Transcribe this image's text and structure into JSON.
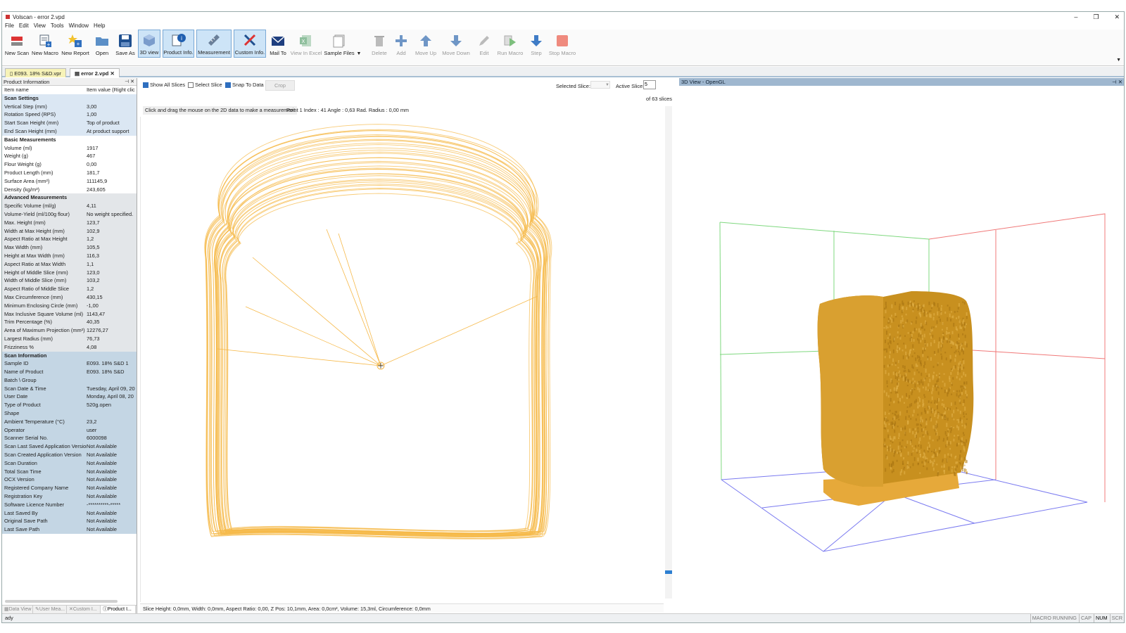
{
  "window": {
    "title": "Volscan - error 2.vpd",
    "minimize": "–",
    "restore": "❐",
    "close": "✕"
  },
  "menu": [
    "File",
    "Edit",
    "View",
    "Tools",
    "Window",
    "Help"
  ],
  "toolbar": {
    "new_scan": "New Scan",
    "new_macro": "New Macro",
    "new_report": "New Report",
    "open": "Open",
    "save_as": "Save As",
    "view3d": "3D view",
    "product_info": "Product Info.",
    "measurement": "Measurement",
    "custom_info": "Custom Info.",
    "mail_to": "Mail To",
    "view_in_excel": "View In Excel",
    "sample_files": "Sample Files",
    "delete": "Delete",
    "add": "Add",
    "move_up": "Move Up",
    "move_down": "Move Down",
    "edit": "Edit",
    "run_macro": "Run Macro",
    "step": "Step",
    "stop_macro": "Stop Macro"
  },
  "doc_tabs": [
    "E093. 18% S&D.vpr",
    "error 2.vpd"
  ],
  "product_panel": {
    "title": "Product Information",
    "header": {
      "k": "Item name",
      "v": "Item value (Right clic"
    },
    "rows": [
      {
        "k": "Scan Settings",
        "v": "",
        "sec": true,
        "g": "g1"
      },
      {
        "k": "Vertical Step (mm)",
        "v": "3,00",
        "g": "g1"
      },
      {
        "k": "Rotation Speed (RPS)",
        "v": "1,00",
        "g": "g1"
      },
      {
        "k": "Start Scan Height (mm)",
        "v": "Top of product",
        "g": "g1"
      },
      {
        "k": "End Scan Height (mm)",
        "v": "At product support",
        "g": "g1"
      },
      {
        "k": "Basic Measurements",
        "v": "",
        "sec": true,
        "g": "wh"
      },
      {
        "k": "Volume (ml)",
        "v": "1917",
        "g": "wh"
      },
      {
        "k": "Weight (g)",
        "v": "467",
        "g": "wh"
      },
      {
        "k": "Flour Weight (g)",
        "v": "0,00",
        "g": "wh"
      },
      {
        "k": "Product Length (mm)",
        "v": "181,7",
        "g": "wh"
      },
      {
        "k": "Surface Area (mm²)",
        "v": "111145,9",
        "g": "wh"
      },
      {
        "k": "Density (kg/m³)",
        "v": "243,605",
        "g": "wh"
      },
      {
        "k": "Advanced Measurements",
        "v": "",
        "sec": true,
        "g": "g2"
      },
      {
        "k": "Specific Volume (ml/g)",
        "v": "4,11",
        "g": "g2"
      },
      {
        "k": "Volume-Yield (ml/100g flour)",
        "v": "No weight specified.",
        "g": "g2"
      },
      {
        "k": "Max. Height (mm)",
        "v": "123,7",
        "g": "g2"
      },
      {
        "k": "Width at Max Height (mm)",
        "v": "102,9",
        "g": "g2"
      },
      {
        "k": "Aspect Ratio at Max Height",
        "v": "1,2",
        "g": "g2"
      },
      {
        "k": "Max Width (mm)",
        "v": "105,5",
        "g": "g2"
      },
      {
        "k": "Height at Max Width (mm)",
        "v": "116,3",
        "g": "g2"
      },
      {
        "k": "Aspect Ratio at Max Width",
        "v": "1,1",
        "g": "g2"
      },
      {
        "k": "Height of Middle Slice (mm)",
        "v": "123,0",
        "g": "g2"
      },
      {
        "k": "Width of Middle Slice (mm)",
        "v": "103,2",
        "g": "g2"
      },
      {
        "k": "Aspect Ratio of Middle Slice",
        "v": "1,2",
        "g": "g2"
      },
      {
        "k": "Max Circumference (mm)",
        "v": "430,15",
        "g": "g2"
      },
      {
        "k": "Minimum Enclosing Circle (mm)",
        "v": "-1,00",
        "g": "g2"
      },
      {
        "k": "Max Inclusive Square Volume (ml)",
        "v": "1143,47",
        "g": "g2"
      },
      {
        "k": "Trim Percentage (%)",
        "v": "40,35",
        "g": "g2"
      },
      {
        "k": "Area of Maximum Projection (mm²)",
        "v": "12276,27",
        "g": "g2"
      },
      {
        "k": "Largest Radius (mm)",
        "v": "76,73",
        "g": "g2"
      },
      {
        "k": "Frizziness %",
        "v": "4,08",
        "g": "g2"
      },
      {
        "k": "Scan Information",
        "v": "",
        "sec": true,
        "g": "g3"
      },
      {
        "k": "Sample ID",
        "v": "E093. 18% S&D 1",
        "g": "g3"
      },
      {
        "k": "Name of Product",
        "v": "E093. 18% S&D",
        "g": "g3"
      },
      {
        "k": "Batch \\ Group",
        "v": "",
        "g": "g3"
      },
      {
        "k": "Scan Date & Time",
        "v": "Tuesday, April 09, 20",
        "g": "g3"
      },
      {
        "k": "User Date",
        "v": "Monday, April 08, 20",
        "g": "g3"
      },
      {
        "k": "Type of Product",
        "v": "520g.open",
        "g": "g3"
      },
      {
        "k": "Shape",
        "v": "",
        "g": "g3"
      },
      {
        "k": "Ambient Temperature (°C)",
        "v": "23,2",
        "g": "g3"
      },
      {
        "k": "Operator",
        "v": "user",
        "g": "g3"
      },
      {
        "k": "Scanner Serial No.",
        "v": "6000098",
        "g": "g3"
      },
      {
        "k": "Scan Last Saved Application Version",
        "v": "Not Available",
        "g": "g3"
      },
      {
        "k": "Scan Created Application Version",
        "v": "Not Available",
        "g": "g3"
      },
      {
        "k": "Scan Duration",
        "v": "Not Available",
        "g": "g3"
      },
      {
        "k": "Total Scan Time",
        "v": "Not Available",
        "g": "g3"
      },
      {
        "k": "OCX Version",
        "v": "Not Available",
        "g": "g3"
      },
      {
        "k": "Registered Company Name",
        "v": "Not Available",
        "g": "g3"
      },
      {
        "k": "Registration Key",
        "v": "Not Available",
        "g": "g3"
      },
      {
        "k": "Software Licence Number",
        "v": "-**********-*****",
        "g": "g3"
      },
      {
        "k": "Last Saved By",
        "v": "Not Available",
        "g": "g3"
      },
      {
        "k": "Original Save Path",
        "v": "Not Available",
        "g": "g3"
      },
      {
        "k": "Last Save Path",
        "v": "Not Available",
        "g": "g3"
      }
    ],
    "bottom_tabs": [
      "Data View",
      "User Mea...",
      "Custom I...",
      "Product I..."
    ]
  },
  "slice_view": {
    "show_all_slices": "Show All Slices",
    "select_slice": "Select Slice",
    "snap_to_data": "Snap To Data",
    "crop": "Crop",
    "selected_slice_label": "Selected Slice:",
    "active_slice_label": "Active Slice:",
    "active_slice_value": "5",
    "of_slices": "of   63 slices",
    "hint": "Click and drag the mouse on the 2D data to make a measurement",
    "point_readout": "Point 1 Index : 41 Angle : 0,63 Rad. Radius : 0,00 mm",
    "status": "Slice Height: 0,0mm, Width: 0,0mm, Aspect Ratio: 0,00, Z Pos: 10,1mm, Area: 0,0cm², Volume: 15,3ml, Circumference: 0,0mm"
  },
  "view3d": {
    "title": "3D View - OpenGL"
  },
  "statusbar": {
    "ready": "ady",
    "indicators": [
      "MACRO RUNNING",
      "CAP",
      "NUM",
      "SCR"
    ]
  },
  "colors": {
    "contour": "#f6b94a",
    "bread": "#d9a030",
    "accent": "#2f6fbf"
  }
}
